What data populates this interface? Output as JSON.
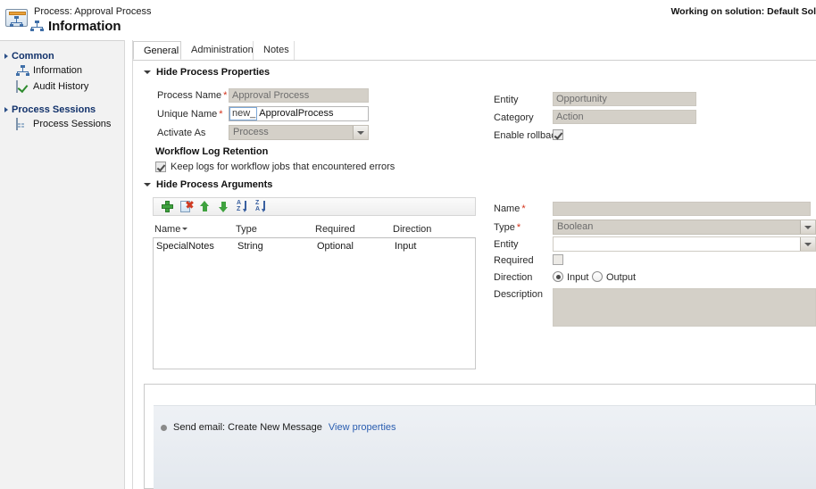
{
  "header": {
    "breadcrumb": "Process: Approval Process",
    "page_title": "Information",
    "solution_text": "Working on solution: Default Sol",
    "process_icon": "process-monitor-icon",
    "title_icon": "process-icon"
  },
  "sidebar": {
    "groups": [
      {
        "label": "Common",
        "items": [
          {
            "label": "Information",
            "icon": "process-icon"
          },
          {
            "label": "Audit History",
            "icon": "audit-history-icon"
          }
        ]
      },
      {
        "label": "Process Sessions",
        "items": [
          {
            "label": "Process Sessions",
            "icon": "process-sessions-icon"
          }
        ]
      }
    ]
  },
  "tabs": [
    {
      "label": "General",
      "active": true
    },
    {
      "label": "Administration",
      "active": false
    },
    {
      "label": "Notes",
      "active": false
    }
  ],
  "process_properties": {
    "section_label": "Hide Process Properties",
    "process_name": {
      "label": "Process Name",
      "required": true,
      "value": "Approval Process"
    },
    "unique_name": {
      "label": "Unique Name",
      "required": true,
      "prefix": "new_",
      "value": "ApprovalProcess"
    },
    "activate_as": {
      "label": "Activate As",
      "required": false,
      "value": "Process"
    },
    "entity": {
      "label": "Entity",
      "required": false,
      "value": "Opportunity"
    },
    "category": {
      "label": "Category",
      "required": false,
      "value": "Action"
    },
    "enable_rollback": {
      "label": "Enable rollback",
      "checked": true
    },
    "workflow_log_retention": {
      "heading": "Workflow Log Retention",
      "keep_logs_label": "Keep logs for workflow jobs that encountered errors",
      "keep_logs_checked": true
    }
  },
  "process_arguments": {
    "section_label": "Hide Process Arguments",
    "toolbar": [
      {
        "name": "add-argument-button",
        "icon": "plus-icon"
      },
      {
        "name": "delete-argument-button",
        "icon": "delete-document-icon"
      },
      {
        "name": "move-up-button",
        "icon": "arrow-up-icon"
      },
      {
        "name": "move-down-button",
        "icon": "arrow-down-icon"
      },
      {
        "name": "sort-ascending-button",
        "icon": "sort-az-icon"
      },
      {
        "name": "sort-descending-button",
        "icon": "sort-za-icon"
      }
    ],
    "columns": [
      "Name",
      "Type",
      "Required",
      "Direction"
    ],
    "sorted_column": "Name",
    "rows": [
      {
        "name": "SpecialNotes",
        "type": "String",
        "required": "Optional",
        "direction": "Input"
      }
    ],
    "detail": {
      "name": {
        "label": "Name",
        "required": true,
        "value": ""
      },
      "type": {
        "label": "Type",
        "required": true,
        "value": "Boolean"
      },
      "entity": {
        "label": "Entity",
        "required": false,
        "value": ""
      },
      "required": {
        "label": "Required",
        "checked": false
      },
      "direction": {
        "label": "Direction",
        "options": [
          "Input",
          "Output"
        ],
        "selected": "Input"
      },
      "description": {
        "label": "Description",
        "value": ""
      }
    }
  },
  "workflow": {
    "step_text": "Send email: Create New Message",
    "view_properties_link": "View properties"
  },
  "colors": {
    "accent_blue": "#2a5db0",
    "required_red": "#d4321a",
    "nav_header_blue": "#12326b",
    "readonly_field": "#d4d0c8",
    "toolbar_green": "#3fa23f"
  }
}
